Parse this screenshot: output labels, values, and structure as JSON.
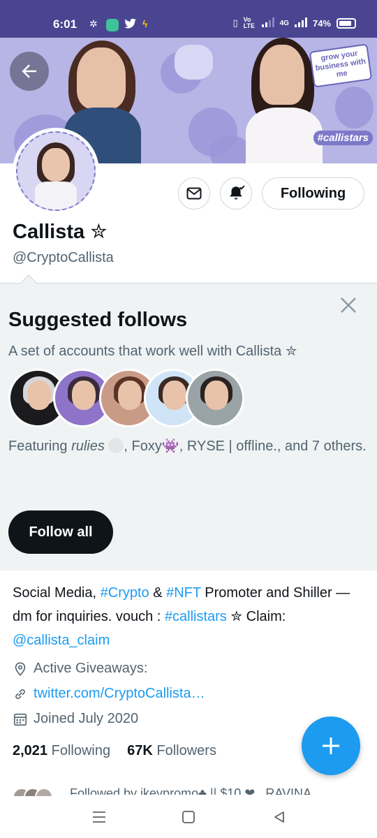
{
  "status_bar": {
    "time": "6:01",
    "network": "4G",
    "battery": "74%",
    "volte": "Vo LTE"
  },
  "banner": {
    "note_text": "grow your business with me",
    "hashtag": "#callistars"
  },
  "profile": {
    "display_name": "Callista ✮",
    "handle": "@CryptoCallista",
    "following_button": "Following"
  },
  "suggested": {
    "title": "Suggested follows",
    "subtitle": "A set of accounts that work well with Callista ✮",
    "featuring_prefix": "Featuring ",
    "featuring_name1": "rulies",
    "featuring_name2": ", Foxy",
    "featuring_rest": ", RYSE | offline., and 7 others.",
    "follow_all": "Follow all"
  },
  "bio": {
    "line1_a": "Social Media, ",
    "tag_crypto": "#Crypto",
    "line1_b": " & ",
    "tag_nft": "#NFT",
    "line1_c": " Promoter and Shiller — dm for inquiries. vouch : ",
    "tag_callistars": "#callistars",
    "line1_d": " ✮ Claim: ",
    "mention_claim": "@callista_claim"
  },
  "meta": {
    "location": "Active Giveaways:",
    "website": "twitter.com/CryptoCallista…",
    "joined": "Joined July 2020"
  },
  "stats": {
    "following_count": "2,021",
    "following_label": "Following",
    "followers_count": "67K",
    "followers_label": "Followers"
  },
  "followed_by": "Followed by ikeypromo♣ || $10 ❤ , RAVINA",
  "colors": {
    "accent": "#1d9bf0",
    "status_bar": "#4a4590",
    "banner": "#b7b4e6",
    "suggest_bg": "#eff3f4"
  }
}
